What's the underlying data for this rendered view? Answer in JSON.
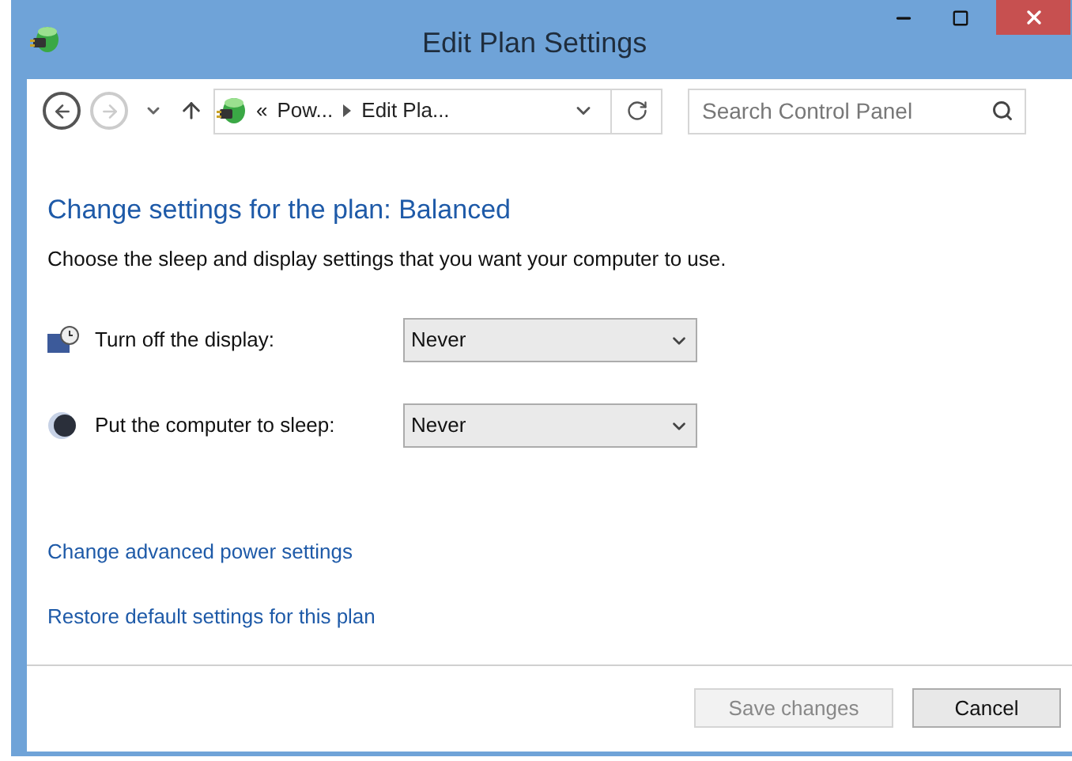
{
  "window": {
    "title": "Edit Plan Settings"
  },
  "nav": {
    "back_disabled": false,
    "forward_disabled": true,
    "breadcrumb": [
      {
        "label": "«"
      },
      {
        "label": "Pow..."
      },
      {
        "label": "Edit Pla..."
      }
    ],
    "search": {
      "placeholder": "Search Control Panel"
    }
  },
  "heading": "Change settings for the plan: Balanced",
  "description": "Choose the sleep and display settings that you want your computer to use.",
  "settings": [
    {
      "kind": "display",
      "label": "Turn off the display:",
      "value": "Never"
    },
    {
      "kind": "sleep",
      "label": "Put the computer to sleep:",
      "value": "Never"
    }
  ],
  "links": [
    "Change advanced power settings",
    "Restore default settings for this plan"
  ],
  "buttons": [
    {
      "label": "Save changes",
      "disabled": true
    },
    {
      "label": "Cancel",
      "disabled": false
    }
  ]
}
